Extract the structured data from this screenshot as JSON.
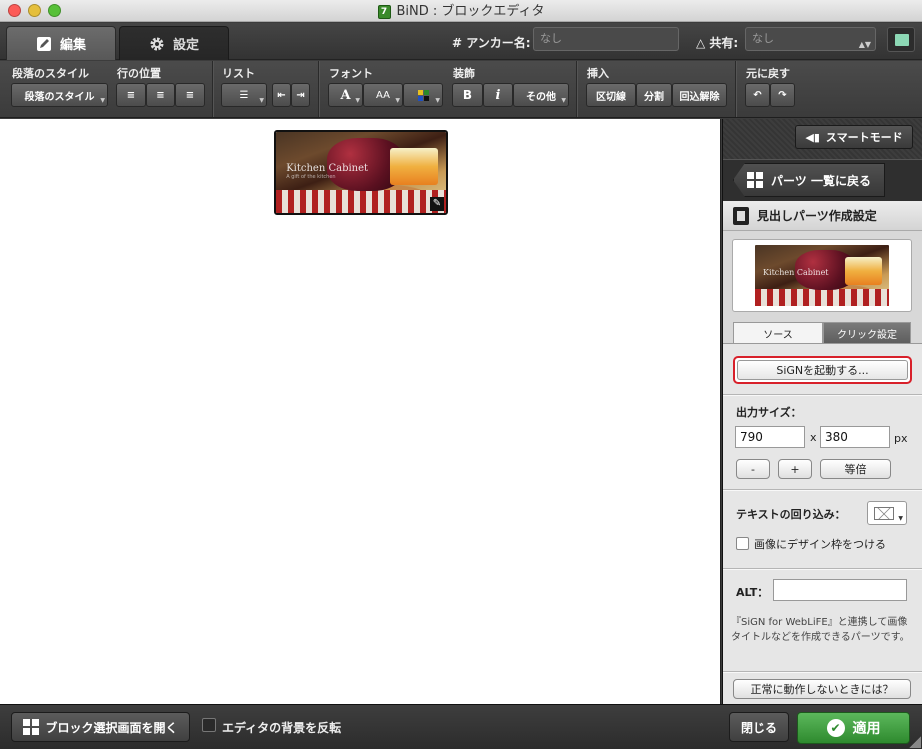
{
  "window": {
    "title": "BiND : ブロックエディタ",
    "app_icon_text": "7"
  },
  "tabs": {
    "edit": "編集",
    "settings": "設定"
  },
  "anchor": {
    "label": "# アンカー名:",
    "placeholder": "なし"
  },
  "share": {
    "label": "共有:",
    "value": "なし"
  },
  "toolbar": {
    "paragraph_style_label": "段落のスタイル",
    "paragraph_style_value": "段落のスタイル",
    "line_position_label": "行の位置",
    "list_label": "リスト",
    "font_label": "フォント",
    "font_button": "A",
    "font_size_button": "AA",
    "decoration_label": "装飾",
    "bold": "B",
    "italic": "i",
    "other": "その他",
    "insert_label": "挿入",
    "divider": "区切線",
    "split": "分割",
    "wrap_release": "回込解除",
    "undo_label": "元に戻す"
  },
  "canvas": {
    "image_title": "Kitchen Cabinet",
    "image_subtitle": "A gift of the kitchen"
  },
  "side": {
    "smart_mode": "スマートモード",
    "parts_list": "パーツ 一覧に戻る",
    "section_title": "見出しパーツ作成設定",
    "tab_source": "ソース",
    "tab_click": "クリック設定",
    "sign_button": "SiGNを起動する...",
    "output_size_label": "出力サイズ：",
    "width": "790",
    "x_sep": "x",
    "height": "380",
    "unit": "px",
    "minus": "-",
    "plus": "+",
    "equal": "等倍",
    "wrap_label": "テキストの回り込み：",
    "frame_label": "画像にデザイン枠をつける",
    "alt_label": "ALT：",
    "alt_value": "",
    "description": "『SiGN for WebLiFE』と連携して画像タイトルなどを作成できるパーツです。",
    "help_button": "正常に動作しないときには？"
  },
  "bottom": {
    "open_block": "ブロック選択画面を開く",
    "invert_bg": "エディタの背景を反転",
    "close": "閉じる",
    "apply": "適用"
  },
  "colors": {
    "apply_green": "#3a9a3a",
    "highlight_red": "#d8202a",
    "book_icon": "#8cd7b4"
  }
}
